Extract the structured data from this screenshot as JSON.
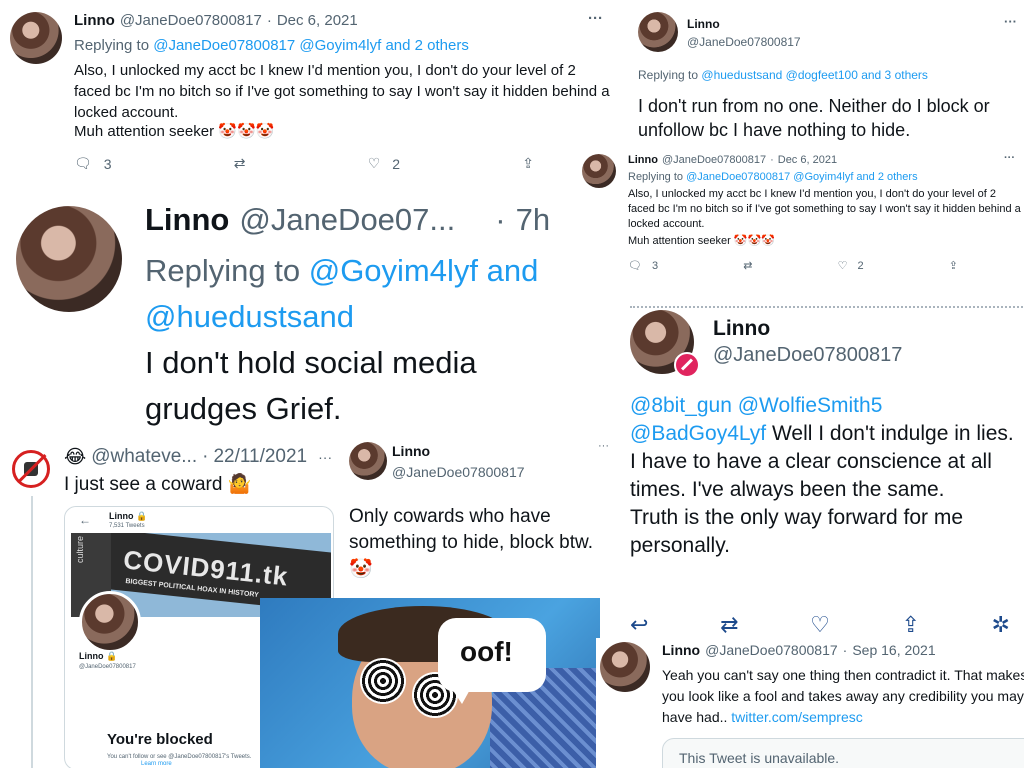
{
  "t1": {
    "name": "Linno",
    "handle": "@JaneDoe07800817",
    "sep": "·",
    "date": "Dec 6, 2021",
    "more": "···",
    "replying_prefix": "Replying to",
    "replying_users": "@JaneDoe07800817 @Goyim4lyf and 2 others",
    "body1": "Also, I unlocked my acct bc I knew I'd mention you, I don't do your level of 2 faced bc I'm no bitch so if I've got something to say I won't say it hidden behind a locked account.",
    "body2": "Muh attention seeker",
    "emoji": "🤡🤡🤡",
    "reply_count": "3",
    "like_count": "2"
  },
  "t2": {
    "name": "Linno",
    "handle": "@JaneDoe07800817",
    "more": "···",
    "replying_prefix": "Replying to",
    "replying_users": "@huedustsand @dogfeet100 and 3 others",
    "body": "I don't run from no one. Neither do I block or unfollow bc I have nothing to hide."
  },
  "t3": {
    "name": "Linno",
    "handle": "@JaneDoe07800817",
    "sep": "·",
    "date": "Dec 6, 2021",
    "more": "···",
    "replying_prefix": "Replying to",
    "replying_users": "@JaneDoe07800817 @Goyim4lyf and 2 others",
    "body1": "Also, I unlocked my acct bc I knew I'd mention you, I don't do your level of 2 faced bc I'm no bitch so if I've got something to say I won't say it hidden behind a locked account.",
    "body2": "Muh attention seeker",
    "emoji": "🤡🤡🤡",
    "reply_count": "3",
    "like_count": "2"
  },
  "t4": {
    "name": "Linno",
    "handle": "@JaneDoe07...",
    "sep": "·",
    "time": "7h",
    "replying_prefix": "Replying to",
    "replying_users1": "@Goyim4lyf and",
    "replying_users2": "@huedustsand",
    "body": "I don't hold social media grudges Grief."
  },
  "t5": {
    "name": "Linno",
    "handle": "@JaneDoe07800817",
    "mentions1": "@8bit_gun @WolfieSmith5",
    "mention2": "@BadGoy4Lyf",
    "body": "Well I don't indulge in lies. I have to have a clear conscience at all times. I've always been the same.",
    "body2": "Truth is the only way forward for me personally."
  },
  "t6": {
    "emoji": "😂",
    "handle": "@whateve...",
    "sep": "·",
    "date": "22/11/2021",
    "more": "···",
    "body": "I just see a coward",
    "body_emoji": "🤷",
    "embed": {
      "name": "Linno",
      "tweets": "7,531 Tweets",
      "banner_text1": "COVID911.tk",
      "banner_text2": "BIGGEST POLITICAL HOAX IN HISTORY",
      "banner_side": "culture",
      "profile_name": "Linno",
      "profile_handle": "@JaneDoe07800817",
      "blocked_title": "You're blocked",
      "blocked_text": "You can't follow or see @JaneDoe07800817's Tweets.",
      "learn_more": "Learn more"
    }
  },
  "t7": {
    "name": "Linno",
    "handle": "@JaneDoe07800817",
    "more": "···",
    "body": "Only cowards who have something to hide, block btw.",
    "emoji": "🤡"
  },
  "meme": {
    "bubble_text": "oof!"
  },
  "t8": {
    "name": "Linno",
    "handle": "@JaneDoe07800817",
    "sep": "·",
    "date": "Sep 16, 2021",
    "body": "Yeah you can't say one thing then contradict it. That makes you look like a fool and takes away any credibility you may have had..",
    "link": "twitter.com/sempresc",
    "unavailable": "This Tweet is unavailable."
  }
}
